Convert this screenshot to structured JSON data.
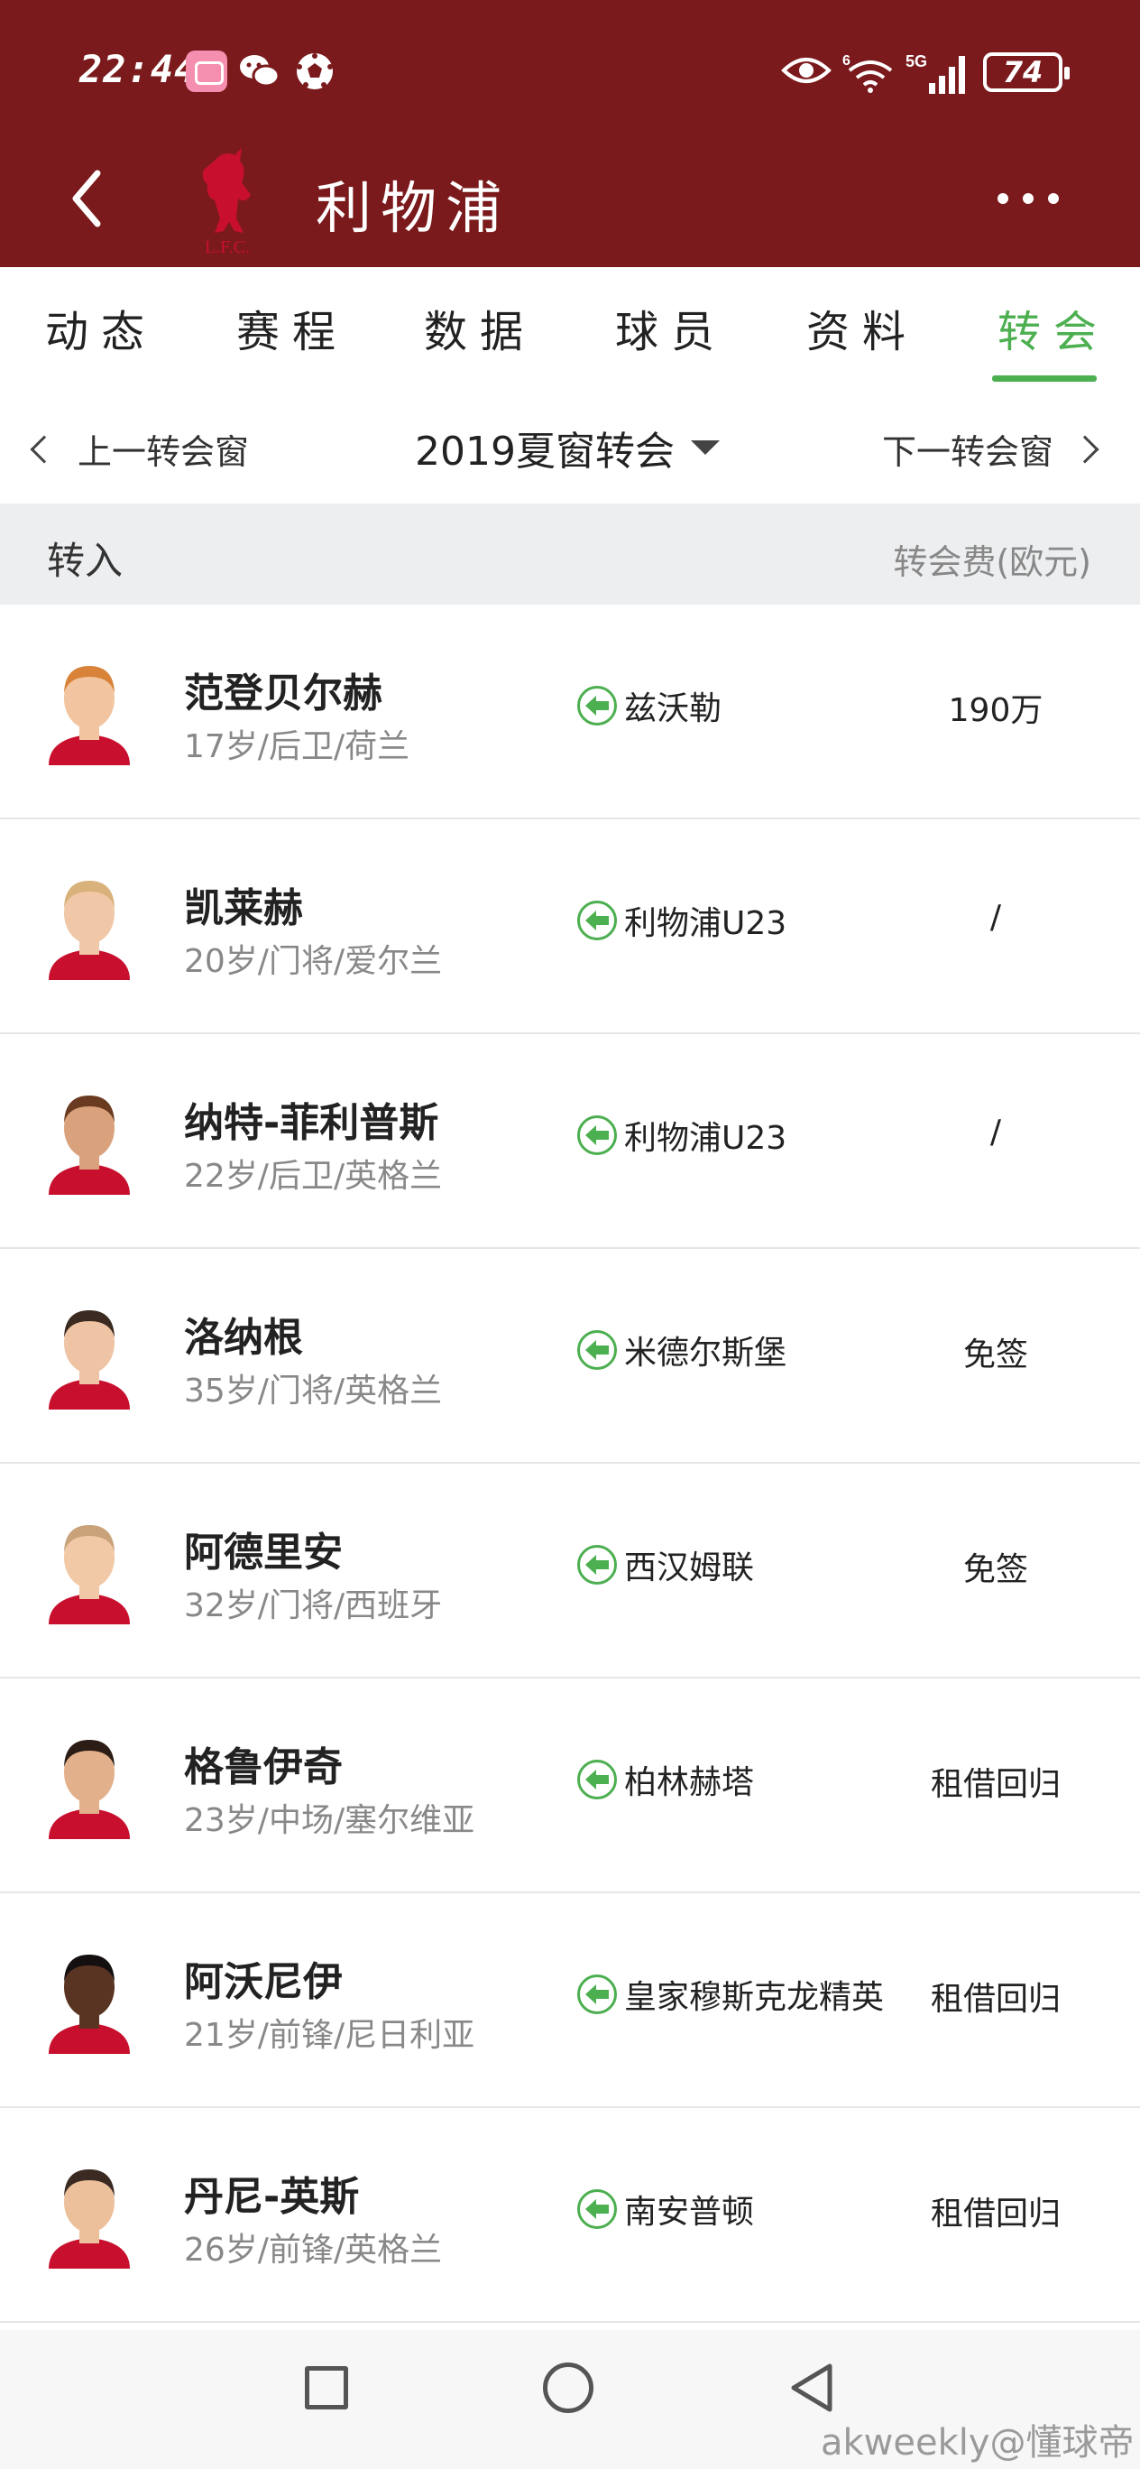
{
  "status_bar": {
    "time": "22:44",
    "network_label": "5G",
    "wifi_label": "6",
    "battery": "74"
  },
  "title_bar": {
    "club_name": "利物浦",
    "logo_text": "L.F.C."
  },
  "tabs": [
    {
      "label": "动态",
      "active": false
    },
    {
      "label": "赛程",
      "active": false
    },
    {
      "label": "数据",
      "active": false
    },
    {
      "label": "球员",
      "active": false
    },
    {
      "label": "资料",
      "active": false
    },
    {
      "label": "转会",
      "active": true
    }
  ],
  "window_bar": {
    "prev_label": "上一转会窗",
    "current_label": "2019夏窗转会",
    "next_label": "下一转会窗"
  },
  "section": {
    "title": "转入",
    "fee_header": "转会费(欧元)"
  },
  "transfers": [
    {
      "name": "范登贝尔赫",
      "info": "17岁/后卫/荷兰",
      "from": "兹沃勒",
      "fee": "190万"
    },
    {
      "name": "凯莱赫",
      "info": "20岁/门将/爱尔兰",
      "from": "利物浦U23",
      "fee": "/"
    },
    {
      "name": "纳特-菲利普斯",
      "info": "22岁/后卫/英格兰",
      "from": "利物浦U23",
      "fee": "/"
    },
    {
      "name": "洛纳根",
      "info": "35岁/门将/英格兰",
      "from": "米德尔斯堡",
      "fee": "免签"
    },
    {
      "name": "阿德里安",
      "info": "32岁/门将/西班牙",
      "from": "西汉姆联",
      "fee": "免签"
    },
    {
      "name": "格鲁伊奇",
      "info": "23岁/中场/塞尔维亚",
      "from": "柏林赫塔",
      "fee": "租借回归"
    },
    {
      "name": "阿沃尼伊",
      "info": "21岁/前锋/尼日利亚",
      "from": "皇家穆斯克龙精英",
      "fee": "租借回归"
    },
    {
      "name": "丹尼-英斯",
      "info": "26岁/前锋/英格兰",
      "from": "南安普顿",
      "fee": "租借回归"
    }
  ],
  "watermark": "akweekly@懂球帝",
  "colors": {
    "header_bg": "#7b1a1c",
    "accent_green": "#4caf50",
    "section_bg": "#eceef0"
  }
}
